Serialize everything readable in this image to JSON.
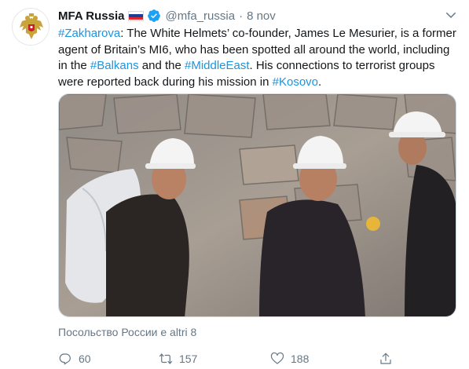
{
  "account": {
    "name": "MFA Russia",
    "handle": "@mfa_russia",
    "separator": "·",
    "date": "8 nov"
  },
  "tweet": {
    "t1": "#Zakharova",
    "t2": ": The White Helmets’ co-founder, James Le Mesurier, is a former agent of Britain’s MI6, who has been spotted all around the world, including in the ",
    "t3": "#Balkans",
    "t4": " and the ",
    "t5": "#MiddleEast",
    "t6": ". His connections to terrorist groups were reported back during his mission in ",
    "t7": "#Kosovo",
    "t8": "."
  },
  "liked_by": "Посольство России e altri 8",
  "stats": {
    "replies": "60",
    "retweets": "157",
    "likes": "188"
  },
  "colors": {
    "link": "#1b95e0",
    "muted": "#657786",
    "verified": "#1da1f2"
  },
  "icons": [
    "verified-badge-icon",
    "chevron-down-icon",
    "reply-icon",
    "retweet-icon",
    "like-icon",
    "share-icon"
  ]
}
